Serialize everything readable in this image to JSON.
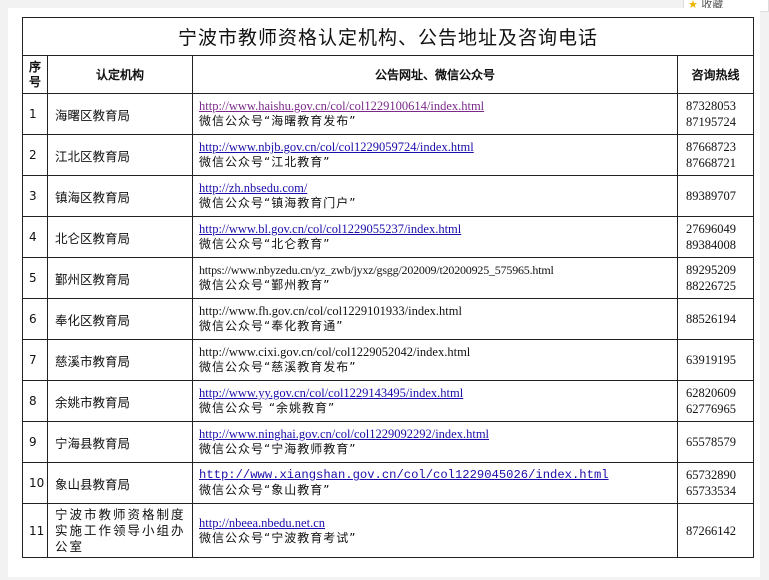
{
  "favorite_label": "收藏",
  "title": "宁波市教师资格认定机构、公告地址及咨询电话",
  "headers": {
    "seq_1": "序",
    "seq_2": "号",
    "org": "认定机构",
    "addr": "公告网址、微信公众号",
    "tel": "咨询热线"
  },
  "rows": [
    {
      "seq": "1",
      "org": "海曙区教育局",
      "url": "http://www.haishu.gov.cn/col/col1229100614/index.html",
      "wechat": "微信公众号“海曙教育发布”",
      "tel1": "87328053",
      "tel2": "87195724"
    },
    {
      "seq": "2",
      "org": "江北区教育局",
      "url": "http://www.nbjb.gov.cn/col/col1229059724/index.html",
      "wechat": "微信公众号“江北教育”",
      "tel1": "87668723",
      "tel2": "87668721"
    },
    {
      "seq": "3",
      "org": "镇海区教育局",
      "url": "http://zh.nbsedu.com/",
      "wechat": "微信公众号“镇海教育门户”",
      "tel1": "89389707",
      "tel2": ""
    },
    {
      "seq": "4",
      "org": "北仑区教育局",
      "url": "http://www.bl.gov.cn/col/col1229055237/index.html",
      "wechat": "微信公众号“北仑教育”",
      "tel1": "27696049",
      "tel2": "89384008"
    },
    {
      "seq": "5",
      "org": "鄞州区教育局",
      "url": "https://www.nbyzedu.cn/yz_zwb/jyxz/gsgg/202009/t20200925_575965.html",
      "wechat": "微信公众号“鄞州教育”",
      "tel1": "89295209",
      "tel2": "88226725"
    },
    {
      "seq": "6",
      "org": "奉化区教育局",
      "url": "http://www.fh.gov.cn/col/col1229101933/index.html",
      "wechat": "微信公众号“奉化教育通”",
      "tel1": "88526194",
      "tel2": ""
    },
    {
      "seq": "7",
      "org": "慈溪市教育局",
      "url": "http://www.cixi.gov.cn/col/col1229052042/index.html",
      "wechat": "微信公众号“慈溪教育发布”",
      "tel1": "63919195",
      "tel2": ""
    },
    {
      "seq": "8",
      "org": "余姚市教育局",
      "url": "http://www.yy.gov.cn/col/col1229143495/index.html",
      "wechat": "微信公众号 “余姚教育”",
      "tel1": "62820609",
      "tel2": "62776965"
    },
    {
      "seq": "9",
      "org": "宁海县教育局",
      "url": "http://www.ninghai.gov.cn/col/col1229092292/index.html",
      "wechat": "微信公众号“宁海教师教育”",
      "tel1": "65578579",
      "tel2": ""
    },
    {
      "seq": "10",
      "org": "象山县教育局",
      "url": "http://www.xiangshan.gov.cn/col/col1229045026/index.html",
      "wechat": "微信公众号“象山教育”",
      "tel1": "65732890",
      "tel2": "65733534"
    },
    {
      "seq": "11",
      "org": "宁波市教师资格制度实施工作领导小组办公室",
      "url": "http://nbeea.nbedu.net.cn",
      "wechat": "微信公众号“宁波教育考试”",
      "tel1": "87266142",
      "tel2": ""
    }
  ]
}
